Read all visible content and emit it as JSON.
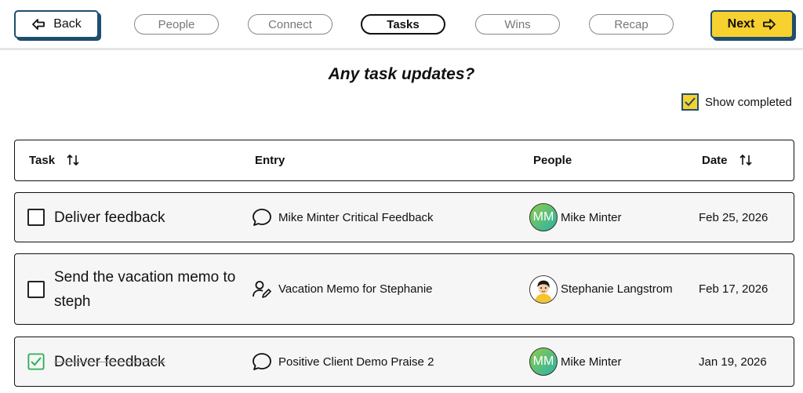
{
  "nav": {
    "back_label": "Back",
    "next_label": "Next",
    "steps": [
      {
        "label": "People"
      },
      {
        "label": "Connect"
      },
      {
        "label": "Tasks"
      },
      {
        "label": "Wins"
      },
      {
        "label": "Recap"
      }
    ],
    "active_step": "Tasks"
  },
  "page": {
    "title": "Any task updates?",
    "show_completed_label": "Show completed",
    "show_completed_checked": true
  },
  "table": {
    "columns": {
      "task": "Task",
      "entry": "Entry",
      "people": "People",
      "date": "Date"
    },
    "rows": [
      {
        "task": "Deliver feedback",
        "completed": false,
        "entry_icon": "speech-bubble-icon",
        "entry": "Mike Minter Critical Feedback",
        "person_avatar": "MM",
        "person": "Mike Minter",
        "date": "Feb 25, 2026"
      },
      {
        "task": "Send the vacation memo to steph",
        "completed": false,
        "entry_icon": "person-edit-icon",
        "entry": "Vacation Memo for Stephanie",
        "person_avatar": "photo",
        "person": "Stephanie Langstrom",
        "date": "Feb 17, 2026"
      },
      {
        "task": "Deliver feedback",
        "completed": true,
        "entry_icon": "speech-bubble-icon",
        "entry": "Positive Client Demo Praise 2",
        "person_avatar": "MM",
        "person": "Mike Minter",
        "date": "Jan 19, 2026"
      }
    ]
  },
  "colors": {
    "accent_yellow": "#f7d130",
    "accent_navy": "#1f4e6e",
    "check_green": "#2fae5a",
    "row_bg": "#f6f6f6"
  }
}
